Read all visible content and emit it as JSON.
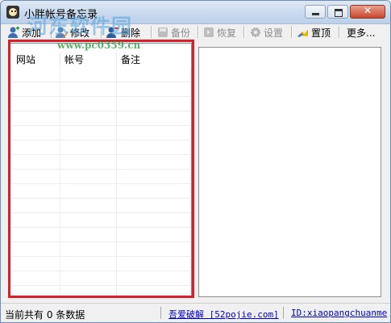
{
  "window": {
    "title": "小胖帐号备忘录"
  },
  "watermark": {
    "brand": "河东软件园",
    "url": "www.pc0359.cn"
  },
  "toolbar": {
    "add": "添加",
    "edit": "修改",
    "delete": "删除",
    "backup": "备份",
    "restore": "恢复",
    "settings": "设置",
    "pin": "置顶",
    "more": "更多..."
  },
  "list": {
    "columns": [
      "网站",
      "帐号",
      "备注"
    ],
    "rows": []
  },
  "status": {
    "count_text": "当前共有 0 条数据",
    "link1": "吾爱破解 [52pojie.com]",
    "link2": "ID:xiaopangchuanme"
  },
  "colors": {
    "highlight": "#d8202a",
    "link": "#0000cc"
  }
}
